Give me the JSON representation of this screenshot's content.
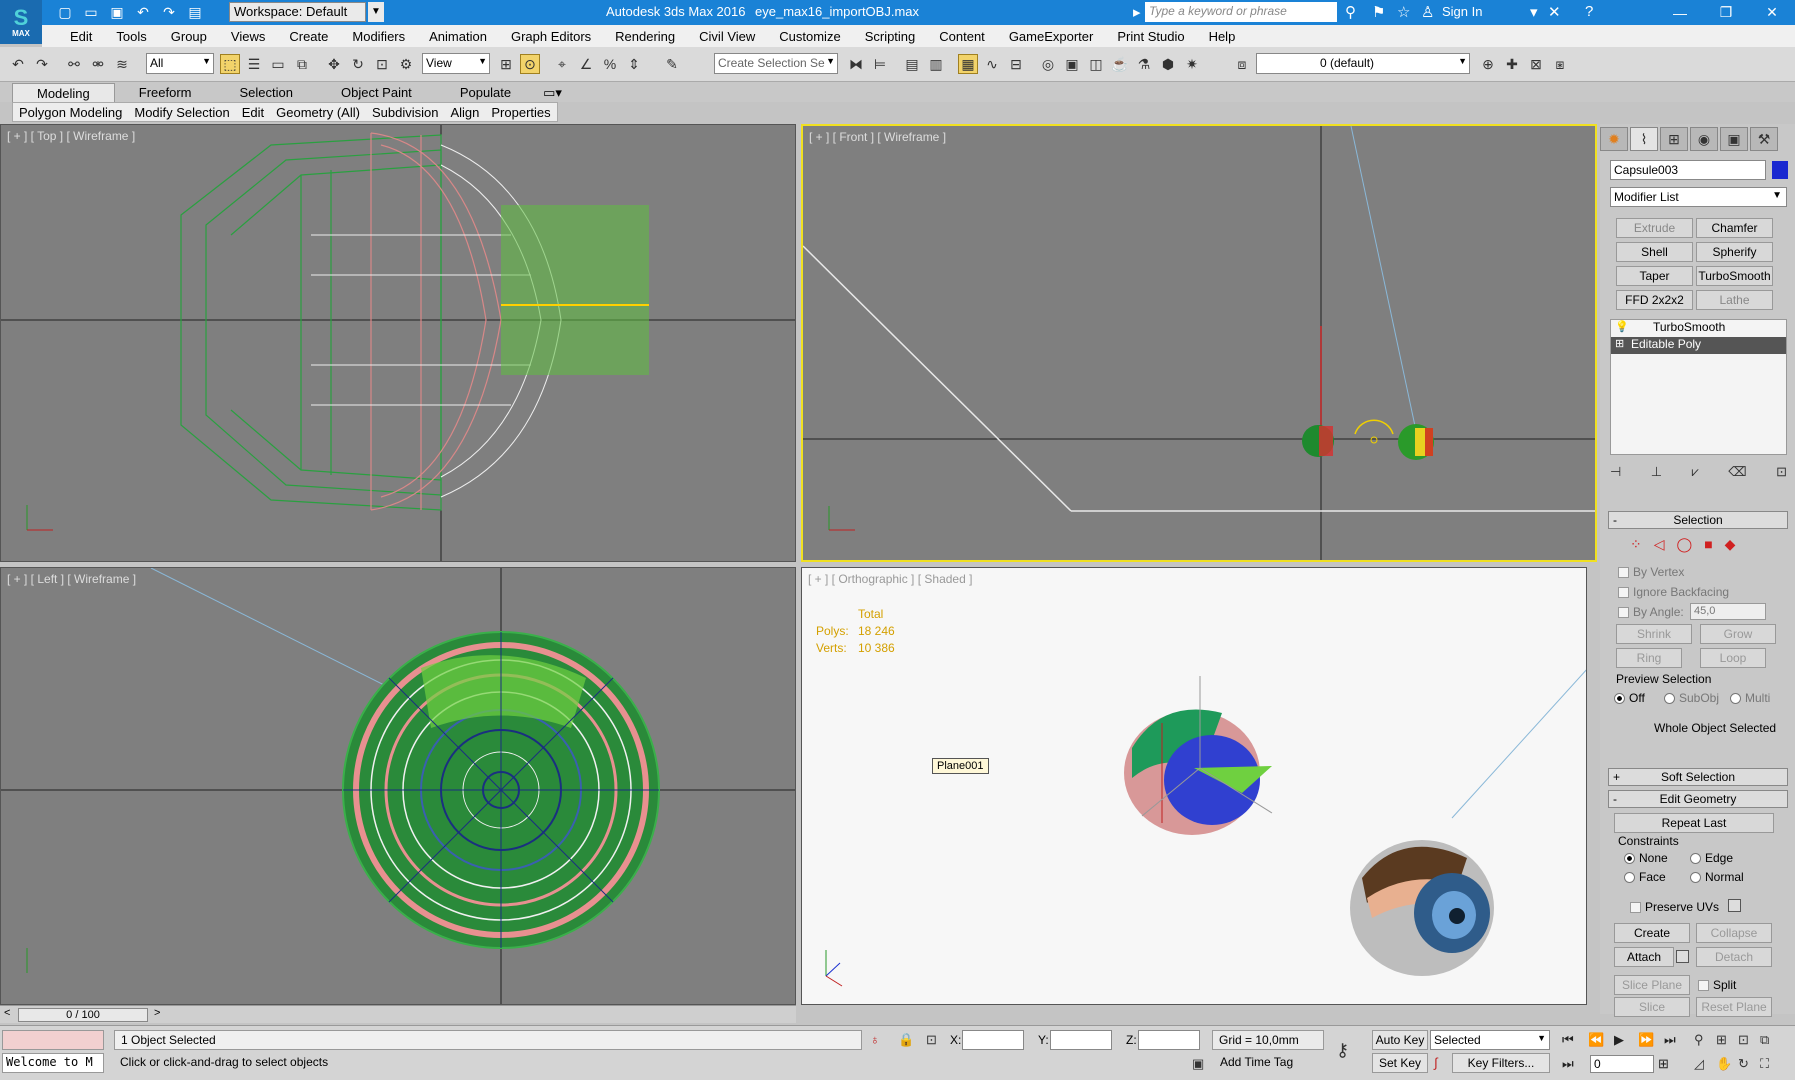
{
  "title_bar": {
    "app_title": "Autodesk 3ds Max 2016",
    "file_title": "eye_max16_importOBJ.max",
    "workspace": "Workspace: Default",
    "search_placeholder": "Type a keyword or phrase",
    "sign_in": "Sign In",
    "logo_text": "MAX"
  },
  "menu": [
    "Edit",
    "Tools",
    "Group",
    "Views",
    "Create",
    "Modifiers",
    "Animation",
    "Graph Editors",
    "Rendering",
    "Civil View",
    "Customize",
    "Scripting",
    "Content",
    "GameExporter",
    "Print Studio",
    "Help"
  ],
  "toolbar": {
    "filter": "All",
    "ref_coord": "View",
    "selection_set": "Create Selection Se",
    "layer": "0 (default)"
  },
  "ribbon_tabs": [
    "Modeling",
    "Freeform",
    "Selection",
    "Object Paint",
    "Populate"
  ],
  "ribbon_sub": [
    "Polygon Modeling",
    "Modify Selection",
    "Edit",
    "Geometry (All)",
    "Subdivision",
    "Align",
    "Properties"
  ],
  "viewports": {
    "top": "[ + ] [ Top ] [ Wireframe ]",
    "front": "[ + ] [ Front ] [ Wireframe ]",
    "left": "[ + ] [ Left ] [ Wireframe ]",
    "persp": "[ + ] [ Orthographic ] [ Shaded ]",
    "stats": {
      "total": "Total",
      "polys_label": "Polys:",
      "polys": "18 246",
      "verts_label": "Verts:",
      "verts": "10 386"
    },
    "plane_tag": "Plane001"
  },
  "command_panel": {
    "object_name": "Capsule003",
    "object_color": "#1a28d0",
    "modifier_list": "Modifier List",
    "mod_buttons": [
      "Extrude",
      "Chamfer",
      "Shell",
      "Spherify",
      "Taper",
      "TurboSmooth",
      "FFD 2x2x2",
      "Lathe"
    ],
    "stack": [
      "TurboSmooth",
      "Editable Poly"
    ],
    "selection": {
      "header": "Selection",
      "by_vertex": "By Vertex",
      "ignore_backfacing": "Ignore Backfacing",
      "by_angle": "By Angle:",
      "angle_value": "45,0",
      "shrink": "Shrink",
      "grow": "Grow",
      "ring": "Ring",
      "loop": "Loop",
      "preview_selection": "Preview Selection",
      "off": "Off",
      "subobj": "SubObj",
      "multi": "Multi",
      "whole_object": "Whole Object Selected"
    },
    "soft_selection": "Soft Selection",
    "edit_geometry": {
      "header": "Edit Geometry",
      "repeat_last": "Repeat Last",
      "constraints": "Constraints",
      "none": "None",
      "edge": "Edge",
      "face": "Face",
      "normal": "Normal",
      "preserve_uvs": "Preserve UVs",
      "create": "Create",
      "collapse": "Collapse",
      "attach": "Attach",
      "detach": "Detach",
      "slice_plane": "Slice Plane",
      "split": "Split",
      "slice": "Slice",
      "reset_plane": "Reset Plane"
    }
  },
  "timeline": {
    "frame_range": "0 / 100"
  },
  "status": {
    "welcome": "Welcome to M",
    "selected": "1 Object Selected",
    "prompt": "Click or click-and-drag to select objects",
    "x_label": "X:",
    "y_label": "Y:",
    "z_label": "Z:",
    "grid": "Grid = 10,0mm",
    "add_time_tag": "Add Time Tag",
    "auto_key": "Auto Key",
    "set_key": "Set Key",
    "selected_dd": "Selected",
    "key_filters": "Key Filters...",
    "frame": "0"
  }
}
